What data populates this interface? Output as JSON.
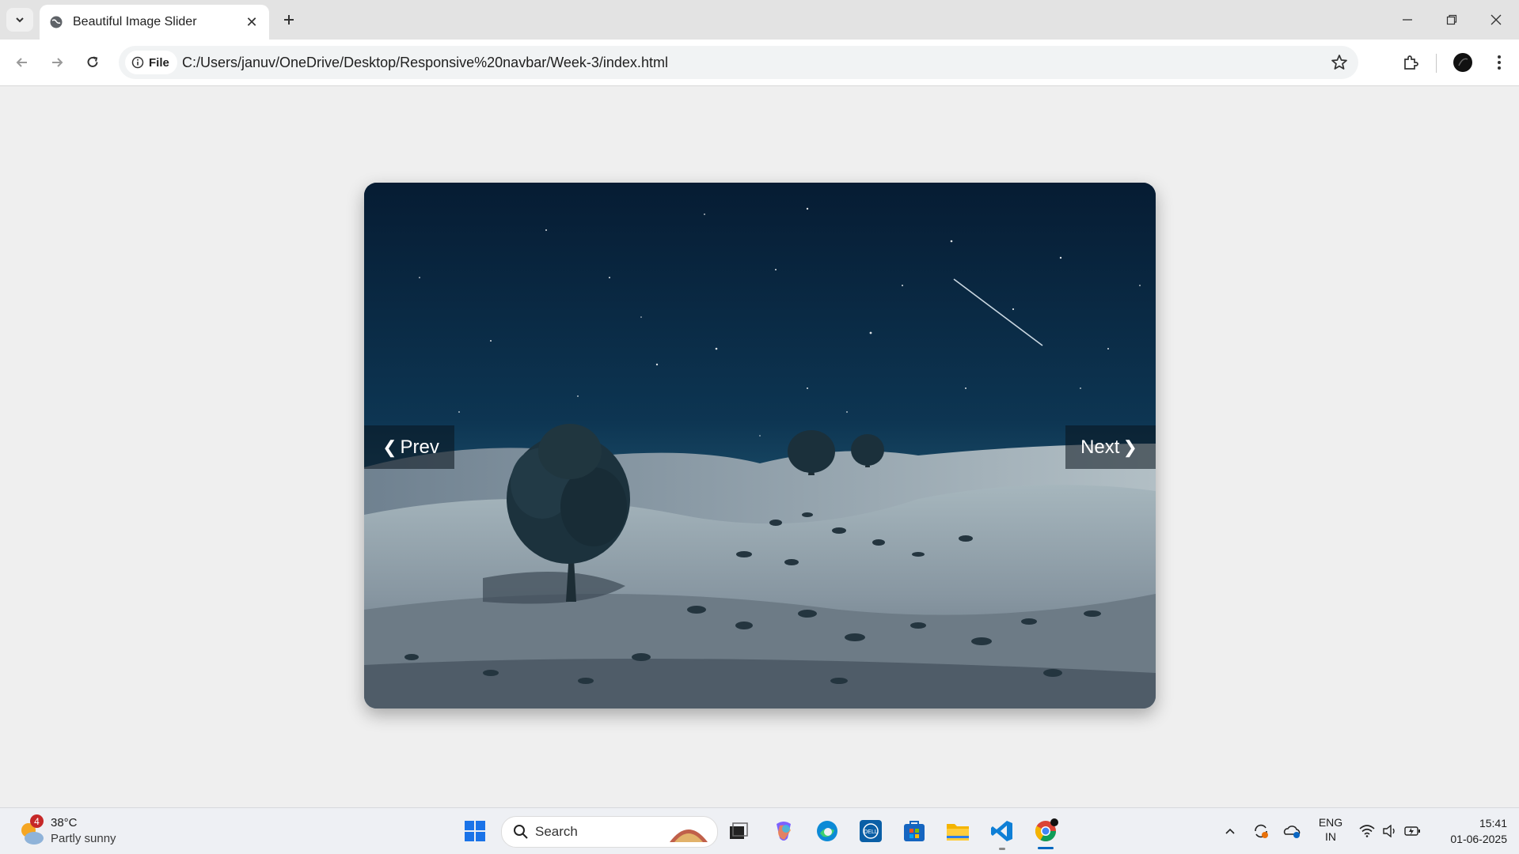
{
  "browser": {
    "tab_title": "Beautiful Image Slider",
    "tab_close": "✕",
    "new_tab": "+",
    "site_chip": "File",
    "url": "C:/Users/januv/OneDrive/Desktop/Responsive%20navbar/Week-3/index.html",
    "icons": [
      "tab-search-icon",
      "globe-icon",
      "close-icon",
      "plus-icon",
      "minimize-icon",
      "restore-icon",
      "close-window-icon",
      "back-icon",
      "forward-icon",
      "reload-icon",
      "info-icon",
      "star-icon",
      "extensions-icon",
      "profile-icon",
      "menu-icon"
    ]
  },
  "slider": {
    "prev_label": "Prev",
    "next_label": "Next",
    "image_description_icon": "night-desert-landscape-image"
  },
  "taskbar": {
    "weather_temp": "38°C",
    "weather_condition": "Partly sunny",
    "weather_badge": "4",
    "search_label": "Search",
    "lang_line1": "ENG",
    "lang_line2": "IN",
    "time": "15:41",
    "date": "01-06-2025",
    "apps": [
      "start-icon",
      "search-icon",
      "task-view-icon",
      "copilot-icon",
      "edge-icon",
      "dell-icon",
      "store-icon",
      "file-explorer-icon",
      "vscode-icon",
      "chrome-icon"
    ],
    "tray": [
      "chevron-up-icon",
      "sync-icon",
      "onedrive-icon",
      "wifi-icon",
      "volume-icon",
      "battery-icon"
    ]
  },
  "colors": {
    "page_bg": "#efefef",
    "sky_top": "#06203a",
    "sky_bottom": "#1e5a78",
    "sand": "#9aa9b4",
    "accent": "#0067c0"
  }
}
